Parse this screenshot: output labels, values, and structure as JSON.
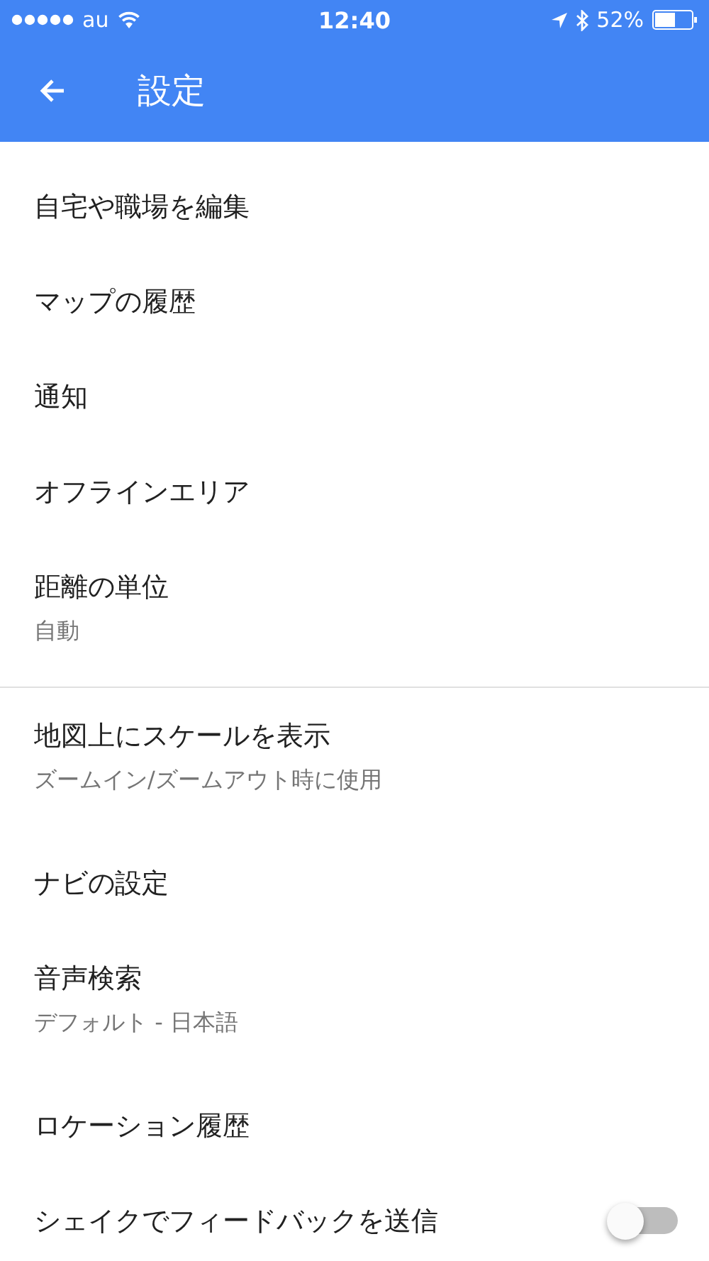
{
  "status_bar": {
    "carrier": "au",
    "time": "12:40",
    "battery": "52%"
  },
  "app_bar": {
    "title": "設定"
  },
  "sections": [
    {
      "items": [
        {
          "kind": "single",
          "title": "自宅や職場を編集"
        },
        {
          "kind": "single",
          "title": "マップの履歴"
        },
        {
          "kind": "single",
          "title": "通知"
        },
        {
          "kind": "single",
          "title": "オフラインエリア"
        },
        {
          "kind": "double",
          "title": "距離の単位",
          "subtitle": "自動"
        }
      ]
    },
    {
      "items": [
        {
          "kind": "double",
          "title": "地図上にスケールを表示",
          "subtitle": "ズームイン/ズームアウト時に使用"
        },
        {
          "kind": "single",
          "title": "ナビの設定"
        },
        {
          "kind": "double",
          "title": "音声検索",
          "subtitle": "デフォルト - 日本語"
        },
        {
          "kind": "single",
          "title": "ロケーション履歴"
        },
        {
          "kind": "toggle",
          "title": "シェイクでフィードバックを送信",
          "on": false
        }
      ]
    }
  ]
}
